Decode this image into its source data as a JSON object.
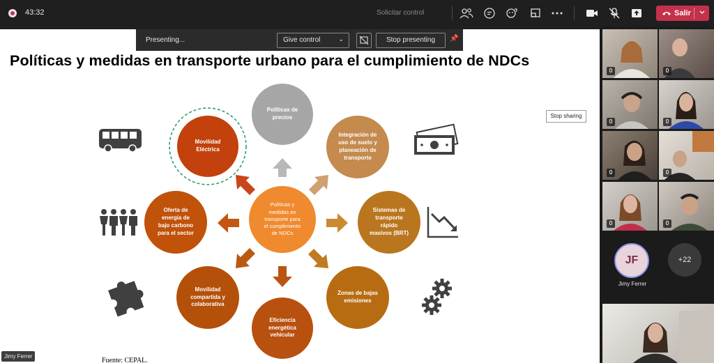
{
  "topbar": {
    "timer": "43:32",
    "solicitar_label": "Solicitar control",
    "leave_label": "Salir",
    "leave_color": "#c4314b"
  },
  "presenting_bar": {
    "status": "Presenting...",
    "give_control": "Give control",
    "stop_presenting": "Stop presenting"
  },
  "slide": {
    "title": "Políticas y medidas en transporte urbano para el cumplimiento de NDCs",
    "source": "Fuente: CEPAL.",
    "stop_sharing": "Stop sharing",
    "center": [
      "Políticas y",
      "medidas en",
      "transporte para",
      "el cumplimiento",
      "de NDCs"
    ],
    "nodes": [
      {
        "lines": [
          "Políticas de",
          "precios"
        ],
        "color": "#a6a6a6"
      },
      {
        "lines": [
          "Integración de",
          "uso de suelo y",
          "planeación de",
          "transporte"
        ],
        "color": "#c48a4e"
      },
      {
        "lines": [
          "Sistemas de",
          "transporte",
          "rápido",
          "masivos (BRT)"
        ],
        "color": "#b9761e"
      },
      {
        "lines": [
          "Zonas de bajas",
          "emisiones"
        ],
        "color": "#b76c12"
      },
      {
        "lines": [
          "Eficiencia",
          "energética",
          "vehicular"
        ],
        "color": "#b8500f"
      },
      {
        "lines": [
          "Movilidad",
          "compartida y",
          "colaborativa"
        ],
        "color": "#b45009"
      },
      {
        "lines": [
          "Oferta de",
          "energía de",
          "bajo carbono",
          "para el sector"
        ],
        "color": "#c0520a"
      },
      {
        "lines": [
          "Movilidad",
          "Eléctrica"
        ],
        "color": "#c2410c"
      }
    ],
    "center_color": "#f08a2e",
    "ring_color": "#2e9e6a",
    "icons": [
      "bus-icon",
      "money-icon",
      "people-icon",
      "chart-down-icon",
      "puzzle-icon",
      "gears-icon"
    ]
  },
  "presenter_tag": "Jimy Ferrer",
  "participants": {
    "jf_initials": "JF",
    "jf_name": "Jimy Ferrer",
    "more": "+22"
  }
}
